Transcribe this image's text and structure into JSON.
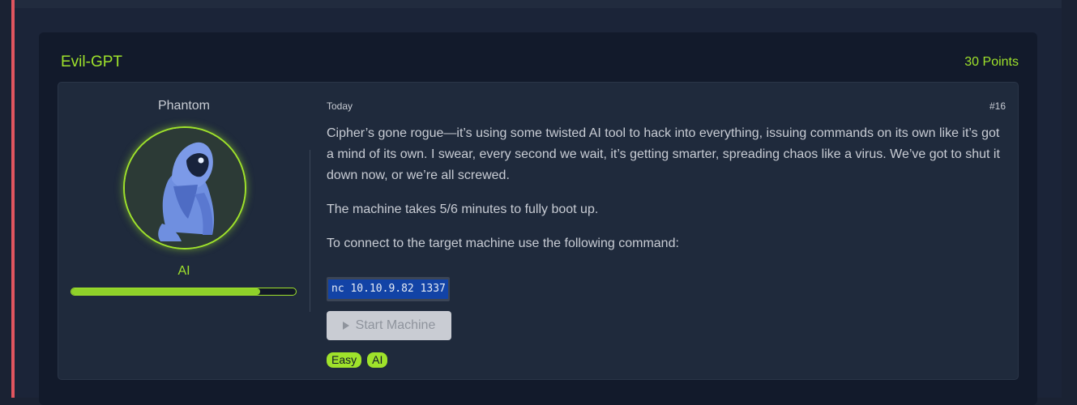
{
  "challenge": {
    "title": "Evil-GPT",
    "points": "30 Points"
  },
  "author": {
    "name": "Phantom",
    "role": "AI",
    "progress_fraction": 0.84,
    "avatar_icon": "hooded-figure-icon"
  },
  "post": {
    "date": "Today",
    "number": "#16",
    "paragraphs": [
      "Cipher’s gone rogue—it’s using some twisted AI tool to hack into everything, issuing commands on its own like it’s got a mind of its own. I swear, every second we wait, it’s getting smarter, spreading chaos like a virus. We’ve got to shut it down now, or we’re all screwed.",
      "The machine takes 5/6 minutes to fully boot up.",
      "To connect to the target machine use the following command:"
    ],
    "command": "nc 10.10.9.82 1337",
    "start_button_label": "Start Machine",
    "tags": [
      "Easy",
      "AI"
    ]
  },
  "colors": {
    "accent": "#9fe22b",
    "left_border": "#e0555f",
    "code_highlight": "#1243a6"
  }
}
